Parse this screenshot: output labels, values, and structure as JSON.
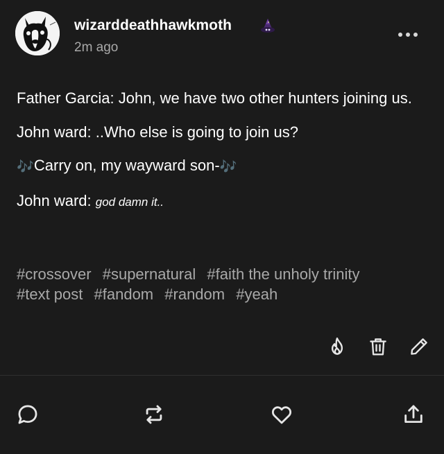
{
  "post": {
    "author": {
      "username": "wizarddeathhawkmoth",
      "badge_icon": "wizard-hat-icon",
      "avatar_icon": "dog-avatar"
    },
    "timestamp": "2m ago",
    "more_icon": "more-horizontal-icon",
    "body": {
      "line1": "Father Garcia: John, we have two other hunters joining us.",
      "line2": "John ward: ..Who else is going to join us?",
      "line3_note_left": "🎶",
      "line3_text": "Carry on, my wayward son-",
      "line3_note_right": "🎶",
      "line4_prefix": "John ward: ",
      "line4_italic": "god damn it.."
    },
    "tags": [
      "#crossover",
      "#supernatural",
      "#faith the unholy trinity",
      "#text post",
      "#fandom",
      "#random",
      "#yeah"
    ],
    "owner_actions": [
      "blaze-icon",
      "delete-icon",
      "edit-icon"
    ],
    "footer_actions": [
      "reply-icon",
      "reblog-icon",
      "like-icon",
      "share-icon"
    ]
  }
}
